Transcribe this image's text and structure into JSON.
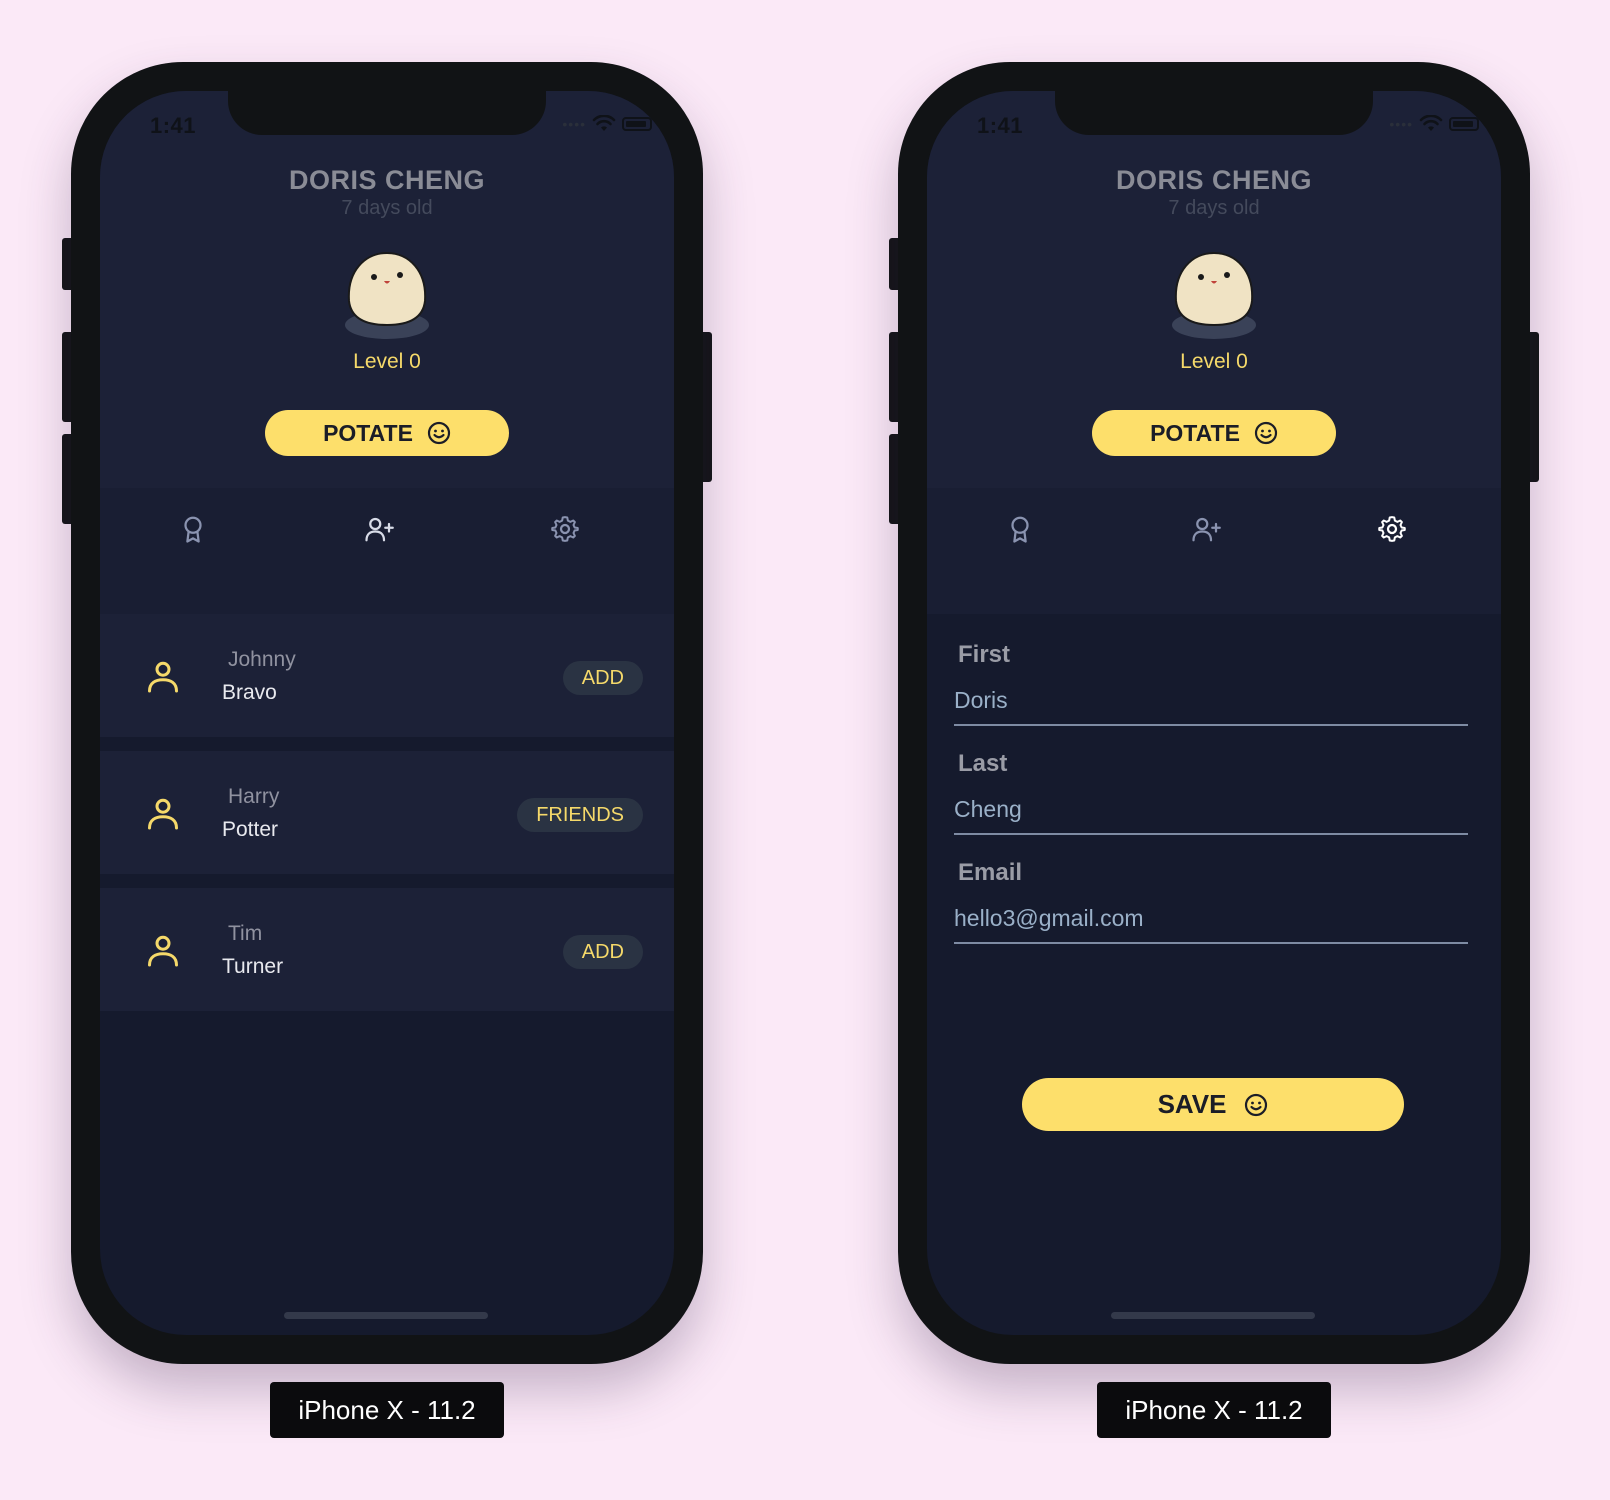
{
  "status": {
    "time": "1:41"
  },
  "profile": {
    "name": "DORIS CHENG",
    "age": "7 days old",
    "level": "Level 0"
  },
  "potate_label": "POTATE",
  "tabs": [
    {
      "icon": "award-icon"
    },
    {
      "icon": "add-friend-icon"
    },
    {
      "icon": "gear-icon"
    }
  ],
  "friends": [
    {
      "first": "Johnny",
      "last": "Bravo",
      "action": "ADD"
    },
    {
      "first": "Harry",
      "last": "Potter",
      "action": "FRIENDS"
    },
    {
      "first": "Tim",
      "last": "Turner",
      "action": "ADD"
    }
  ],
  "settings": {
    "first_label": "First",
    "first_value": "Doris",
    "last_label": "Last",
    "last_value": "Cheng",
    "email_label": "Email",
    "email_value": "hello3@gmail.com",
    "save_label": "SAVE"
  },
  "captions": {
    "left": "iPhone X - 11.2",
    "right": "iPhone X - 11.2"
  },
  "colors": {
    "background": "#fbe9f7",
    "accent": "#fddf6b",
    "screen_bg": "#151a2d",
    "card_bg": "#1c2137",
    "level_text": "#f5d96a"
  }
}
